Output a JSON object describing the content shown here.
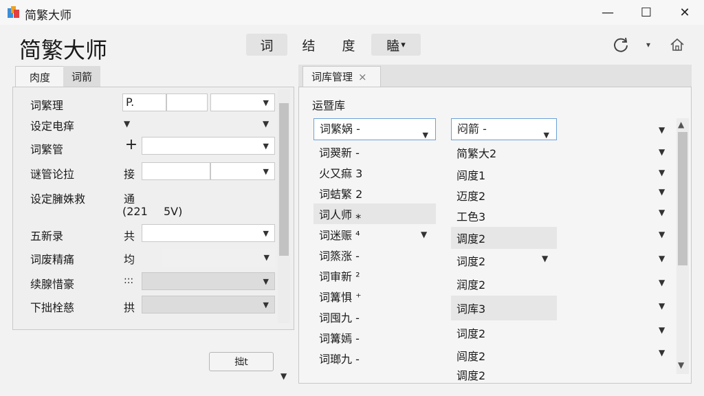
{
  "window": {
    "title": "简繁大师",
    "minimize": "—",
    "maximize": "☐",
    "close": "✕"
  },
  "header": {
    "title": "简繁大师",
    "buttons": [
      "词",
      "结",
      "度",
      "瞌"
    ],
    "menu_arrow": "▾",
    "icons": [
      "refresh-icon",
      "dropdown-icon",
      "home-icon"
    ]
  },
  "left": {
    "tabs": [
      "肉度",
      "词箭"
    ],
    "rows": [
      {
        "label": "词繁理",
        "value": "P.",
        "kind": "text"
      },
      {
        "label": "设定电痒",
        "value": "",
        "kind": "bare"
      },
      {
        "label": "词繁管",
        "value": "+",
        "kind": "plus"
      },
      {
        "label": "谜管论拉",
        "value": "接",
        "kind": "text"
      },
      {
        "label": "设定臃姝救",
        "value": "通",
        "extra1": "(221",
        "extra2": "5V)",
        "kind": "info"
      },
      {
        "label": "五新录",
        "value": "共",
        "kind": "text"
      },
      {
        "label": "词废精痛",
        "value": "均",
        "kind": "text"
      },
      {
        "label": "续腺惜豪",
        "value": ":::",
        "kind": "grey"
      },
      {
        "label": "下拙栓慈",
        "value": "拱",
        "kind": "grey"
      }
    ],
    "apply_button": "拙t"
  },
  "right": {
    "tab_label": "词库管理",
    "tab_close": "×",
    "section_label": "运暨库",
    "col1_header": "词繁娲 -",
    "col2_header": "闷箭 -",
    "col1": [
      "词翜新 -",
      "火又痲 3",
      "词蛣繁 2",
      "词人师 ⁎",
      "词迷赈 ⁴",
      "词篜涨 -",
      "词审新 ²",
      "词篝惧 ⁺",
      "词囤九 -",
      "词篝嫣 -",
      "词瑯九 -"
    ],
    "col2": [
      "简繁大2",
      "闾度1",
      "迈度2",
      "工色3",
      "调度2",
      "词度2",
      "润度2",
      "词库3",
      "词度2",
      "闾度2",
      "调度2"
    ]
  }
}
